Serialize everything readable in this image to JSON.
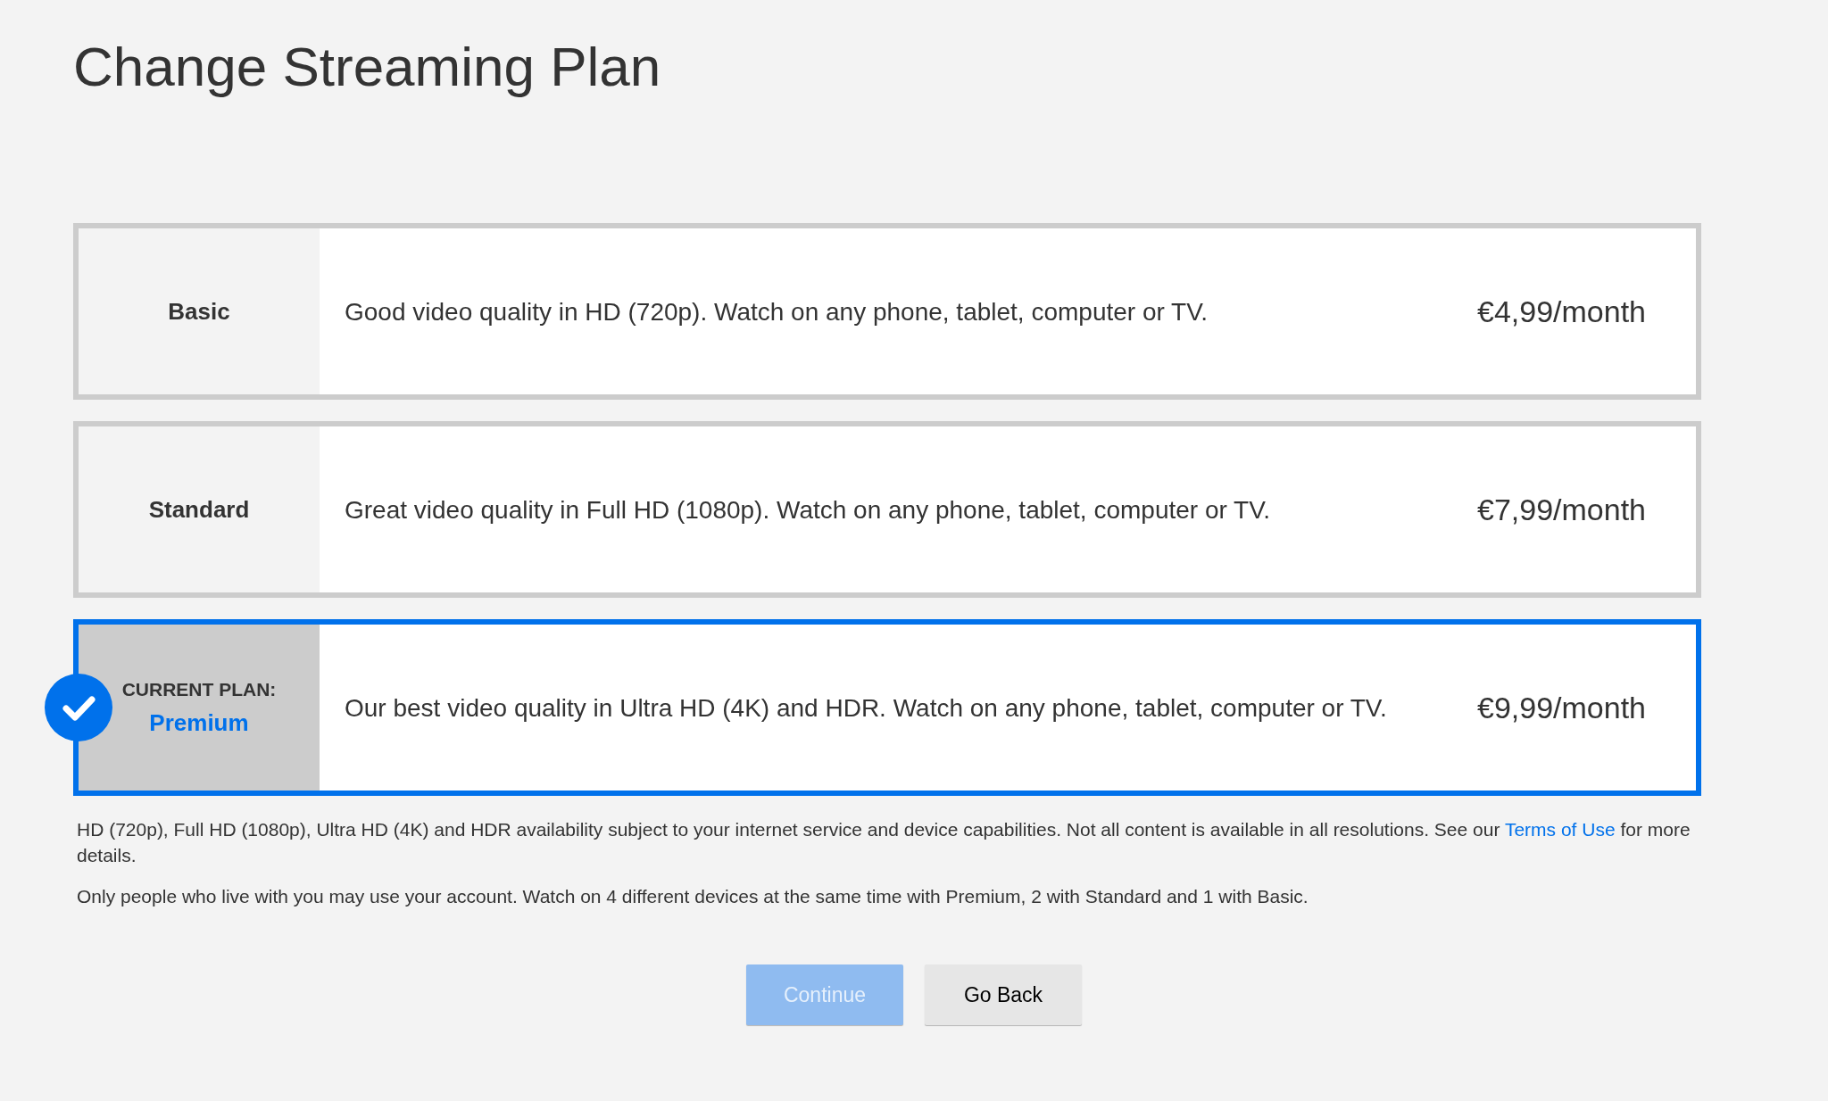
{
  "title": "Change Streaming Plan",
  "plans": [
    {
      "name": "Basic",
      "description": "Good video quality in HD (720p). Watch on any phone, tablet, computer or TV.",
      "price": "€4,99/month",
      "selected": false
    },
    {
      "name": "Standard",
      "description": "Great video quality in Full HD (1080p). Watch on any phone, tablet, computer or TV.",
      "price": "€7,99/month",
      "selected": false
    },
    {
      "name": "Premium",
      "current_label": "CURRENT PLAN:",
      "description": "Our best video quality in Ultra HD (4K) and HDR. Watch on any phone, tablet, computer or TV.",
      "price": "€9,99/month",
      "selected": true
    }
  ],
  "notes": [
    {
      "text": "HD (720p), Full HD (1080p), Ultra HD (4K) and HDR availability subject to your internet service and device capabilities. Not all content is available in all resolutions. See our",
      "link": "Terms of Use",
      "text_after": "for more details."
    },
    {
      "text": "Only people who live with you may use your account. Watch on 4 different devices at the same time with Premium, 2 with Standard and 1 with Basic."
    }
  ],
  "buttons": [
    {
      "label": "Continue",
      "kind": "primary",
      "disabled": true
    },
    {
      "label": "Go Back",
      "kind": "secondary",
      "disabled": false
    }
  ]
}
